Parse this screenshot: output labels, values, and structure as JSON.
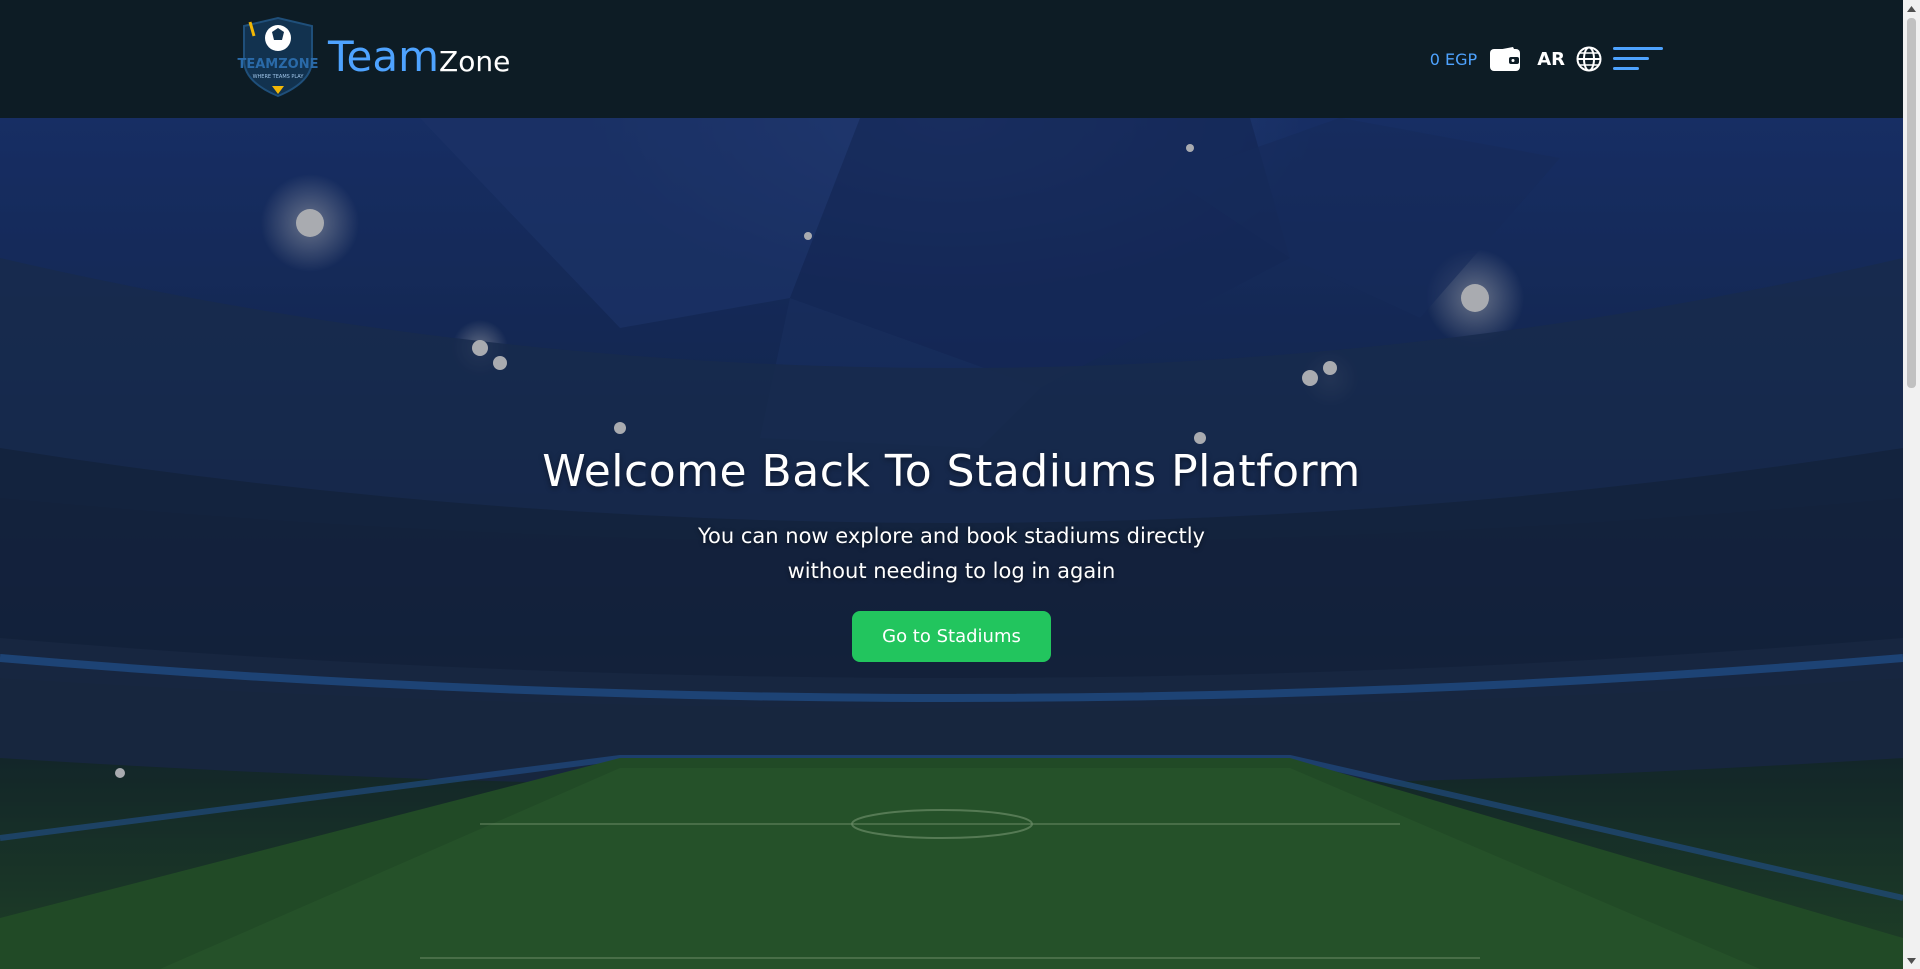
{
  "navbar": {
    "brand_team": "Team",
    "brand_zone": "Zone",
    "logo_text": "TEAMZONE",
    "logo_tagline": "WHERE TEAMS PLAY",
    "balance": "0 EGP",
    "language": "AR",
    "icons": [
      "wallet-icon",
      "globe-icon",
      "menu-icon"
    ]
  },
  "hero": {
    "title": "Welcome Back To Stadiums Platform",
    "subtitle_line1": "You can now explore and book stadiums directly",
    "subtitle_line2": "without needing to log in again",
    "cta_label": "Go to Stadiums"
  },
  "colors": {
    "navbar_bg": "#0d1c25",
    "brand_accent": "#4ea3ff",
    "cta_bg": "#22c55e"
  }
}
